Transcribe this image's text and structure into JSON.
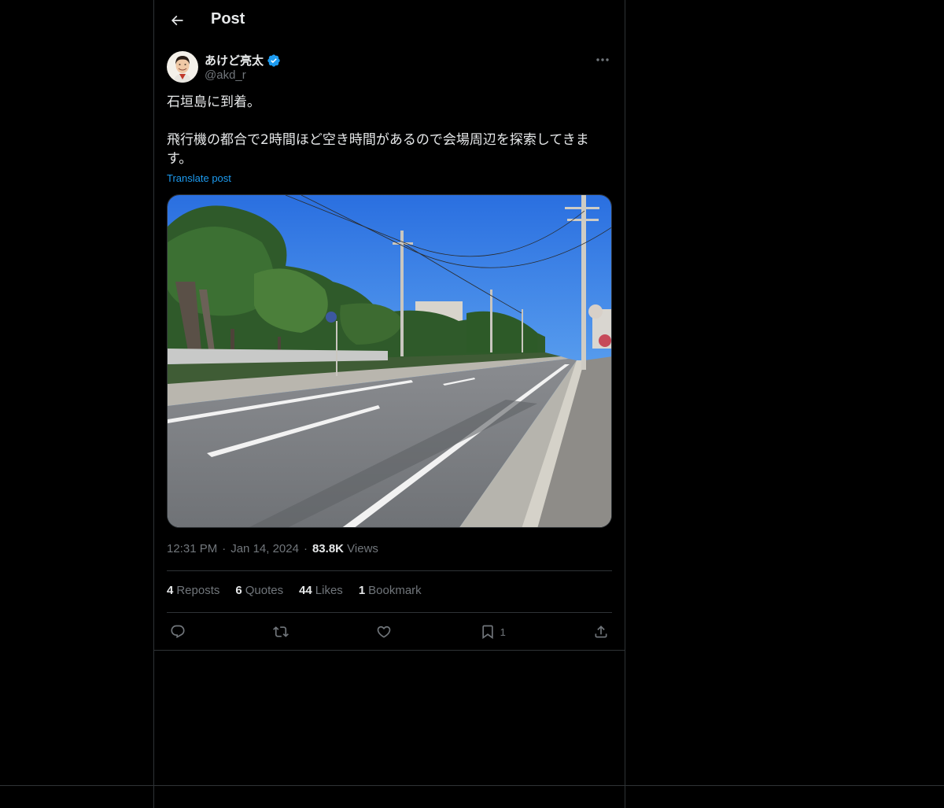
{
  "header": {
    "title": "Post"
  },
  "author": {
    "display_name": "あけど亮太",
    "handle": "@akd_r",
    "verified": true,
    "avatar_icon": "user-avatar"
  },
  "post": {
    "line1": "石垣島に到着。",
    "line2": "飛行機の都合で2時間ほど空き時間があるので会場周辺を探索してきま",
    "line3": "す。",
    "translate_label": "Translate post"
  },
  "meta": {
    "time": "12:31 PM",
    "date": "Jan 14, 2024",
    "views_count": "83.8K",
    "views_label": "Views",
    "separator": "·"
  },
  "stats": {
    "reposts_count": "4",
    "reposts_label": "Reposts",
    "quotes_count": "6",
    "quotes_label": "Quotes",
    "likes_count": "44",
    "likes_label": "Likes",
    "bookmarks_count": "1",
    "bookmarks_label": "Bookmark"
  },
  "actions": {
    "reply_icon": "reply-icon",
    "repost_icon": "repost-icon",
    "like_icon": "heart-icon",
    "bookmark_icon": "bookmark-icon",
    "bookmark_count": "1",
    "share_icon": "share-icon"
  },
  "colors": {
    "background": "#000000",
    "text": "#e7e9ea",
    "muted": "#71767b",
    "link": "#1d9bf0",
    "border": "#2f3336"
  }
}
